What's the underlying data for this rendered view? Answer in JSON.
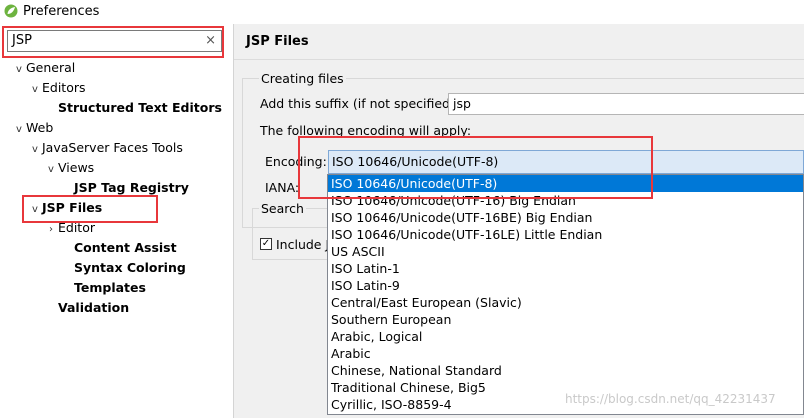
{
  "window": {
    "title": "Preferences"
  },
  "filter": {
    "value": "JSP",
    "clear": "×"
  },
  "tree": [
    {
      "label": "General",
      "chev": "v",
      "bold": false
    },
    {
      "label": "Editors",
      "chev": "v",
      "bold": false
    },
    {
      "label": "Structured Text Editors",
      "chev": "",
      "bold": true
    },
    {
      "label": "Web",
      "chev": "v",
      "bold": false
    },
    {
      "label": "JavaServer Faces Tools",
      "chev": "v",
      "bold": false
    },
    {
      "label": "Views",
      "chev": "v",
      "bold": false
    },
    {
      "label": "JSP Tag Registry",
      "chev": "",
      "bold": true
    },
    {
      "label": "JSP Files",
      "chev": "v",
      "bold": true
    },
    {
      "label": "Editor",
      "chev": "›",
      "bold": false
    },
    {
      "label": "Content Assist",
      "chev": "",
      "bold": true
    },
    {
      "label": "Syntax Coloring",
      "chev": "",
      "bold": true
    },
    {
      "label": "Templates",
      "chev": "",
      "bold": true
    },
    {
      "label": "Validation",
      "chev": "",
      "bold": true
    }
  ],
  "page": {
    "heading": "JSP Files",
    "creating_files": {
      "title": "Creating files",
      "suffix_label": "Add this suffix (if not specified):",
      "suffix_value": "jsp",
      "encoding_note": "The following encoding will apply:",
      "encoding_label": "Encoding:",
      "encoding_value": "ISO 10646/Unicode(UTF-8)",
      "iana_label": "IANA:"
    },
    "search": {
      "title": "Search",
      "include_label": "Include J"
    }
  },
  "encoding_options": [
    "ISO 10646/Unicode(UTF-8)",
    "ISO 10646/Unicode(UTF-16) Big Endian",
    "ISO 10646/Unicode(UTF-16BE) Big Endian",
    "ISO 10646/Unicode(UTF-16LE) Little Endian",
    "US ASCII",
    "ISO Latin-1",
    "ISO Latin-9",
    "Central/East European (Slavic)",
    "Southern European",
    "Arabic, Logical",
    "Arabic",
    "Chinese, National Standard",
    "Traditional Chinese, Big5",
    "Cyrillic, ISO-8859-4"
  ],
  "selected_option_index": 0,
  "watermark": "https://blog.csdn.net/qq_42231437",
  "colors": {
    "highlight": "#e8373b",
    "selection": "#0078d7",
    "app_icon": "#6db33f"
  }
}
